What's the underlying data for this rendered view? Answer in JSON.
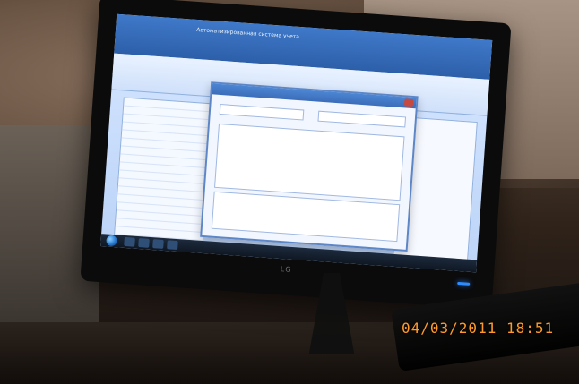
{
  "photo": {
    "scene": "photo",
    "monitor_brand": "LG",
    "timestamp_stamp": "04/03/2011 18:51",
    "colors": {
      "stamp": "#ff9a2a",
      "power_led": "#2f8cff"
    }
  },
  "screen": {
    "app_title": "Автоматизированная система учета"
  }
}
